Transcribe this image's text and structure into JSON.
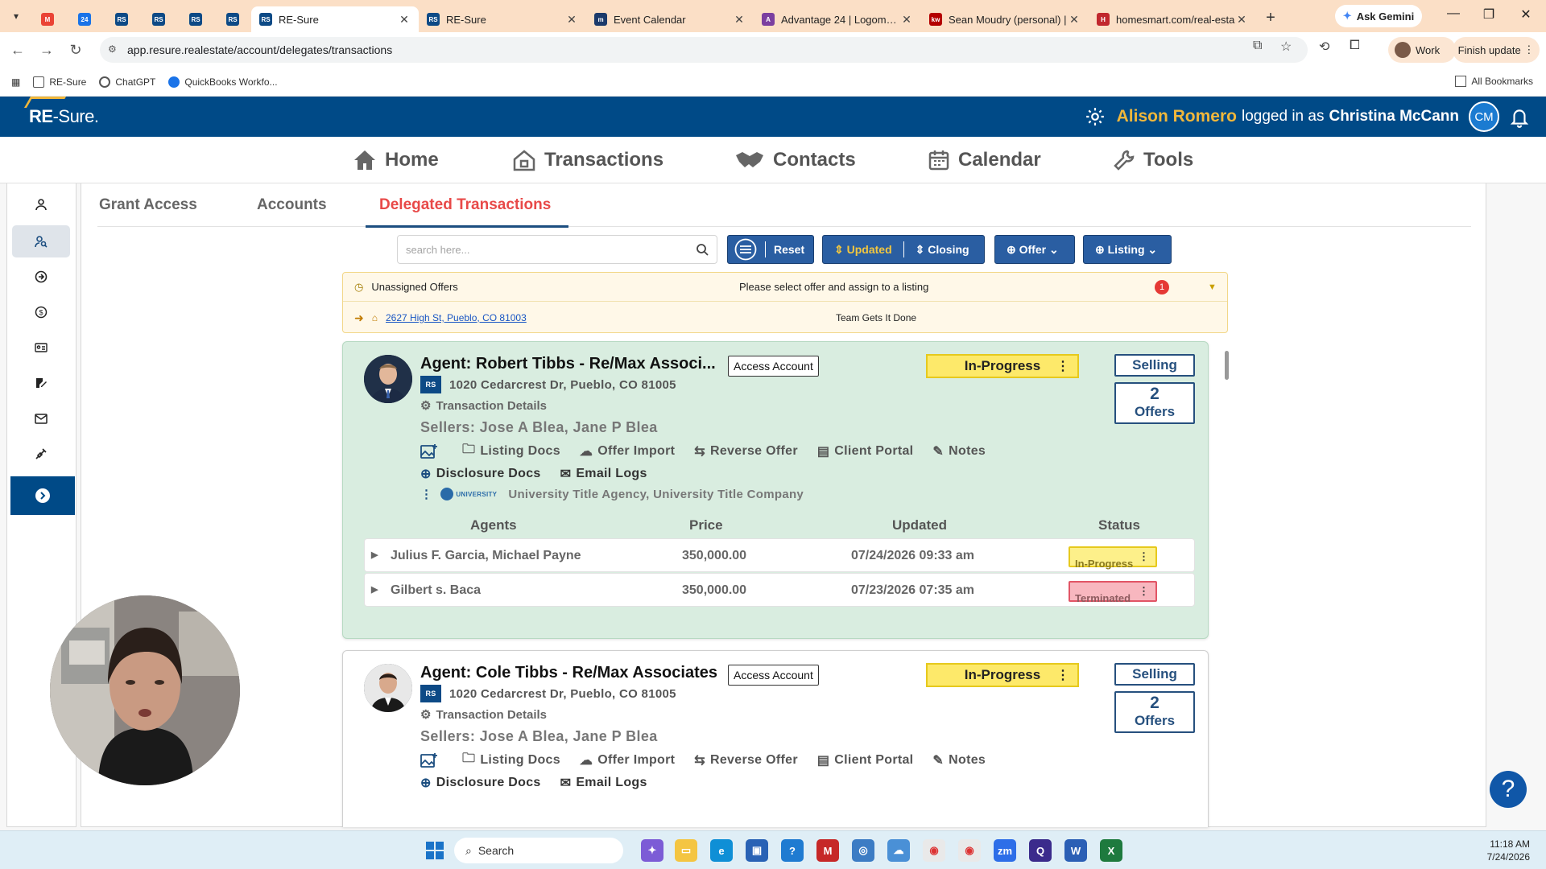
{
  "browser": {
    "tabs": [
      {
        "label": "",
        "favicon": "M",
        "color": "#ea4335",
        "pinned": true
      },
      {
        "label": "",
        "favicon": "24",
        "color": "#1a73e8",
        "pinned": true
      },
      {
        "label": "",
        "favicon": "RS",
        "color": "#0d4a86",
        "pinned": true
      },
      {
        "label": "",
        "favicon": "RS",
        "color": "#0d4a86",
        "pinned": true
      },
      {
        "label": "",
        "favicon": "RS",
        "color": "#0d4a86",
        "pinned": true
      },
      {
        "label": "",
        "favicon": "RS",
        "color": "#0d4a86",
        "pinned": true
      },
      {
        "label": "RE-Sure",
        "favicon": "RS",
        "color": "#0d4a86",
        "pinned": false,
        "active": true
      },
      {
        "label": "RE-Sure",
        "favicon": "RS",
        "color": "#0d4a86",
        "pinned": false
      },
      {
        "label": "Event Calendar",
        "favicon": "m",
        "color": "#1b3a6b",
        "pinned": false
      },
      {
        "label": "Advantage 24 | Logomark",
        "favicon": "A",
        "color": "#7b3fa0",
        "pinned": false
      },
      {
        "label": "Sean Moudry (personal) |",
        "favicon": "kw",
        "color": "#b40000",
        "pinned": false
      },
      {
        "label": "homesmart.com/real-esta",
        "favicon": "H",
        "color": "#c1272d",
        "pinned": false
      }
    ],
    "ask_gemini": "Ask Gemini",
    "url": "app.resure.realestate/account/delegates/transactions",
    "profile_label": "Work",
    "finish_update": "Finish update",
    "bookmarks": [
      "RE-Sure",
      "ChatGPT",
      "QuickBooks Workfo..."
    ],
    "all_bookmarks": "All Bookmarks"
  },
  "header": {
    "logo_main": "RE",
    "logo_sub": "-Sure.",
    "user_name": "Alison Romero",
    "logged_in_as": "logged in as",
    "impersonated": "Christina McCann",
    "avatar_initials": "CM"
  },
  "nav": {
    "home": "Home",
    "transactions": "Transactions",
    "contacts": "Contacts",
    "calendar": "Calendar",
    "tools": "Tools"
  },
  "subtabs": {
    "grant_access": "Grant Access",
    "accounts": "Accounts",
    "delegated": "Delegated Transactions"
  },
  "filters": {
    "search_placeholder": "search here...",
    "reset": "Reset",
    "updated": "Updated",
    "closing": "Closing",
    "offer": "Offer",
    "listing": "Listing"
  },
  "unassigned": {
    "title": "Unassigned Offers",
    "message": "Please select offer and assign to a listing",
    "count": "1",
    "address": "2627 High St, Pueblo, CO 81003",
    "team": "Team Gets It Done"
  },
  "cards": [
    {
      "agent": "Agent: Robert Tibbs - Re/Max Associ...",
      "access_label": "Access Account",
      "status": "In-Progress",
      "side": "Selling",
      "offers_count": "2",
      "offers_label": "Offers",
      "address": "1020 Cedarcrest Dr, Pueblo, CO 81005",
      "details": "Transaction Details",
      "sellers": "Sellers: Jose A Blea, Jane P Blea",
      "listing_docs": "Listing Docs",
      "offer_import": "Offer Import",
      "reverse_offer": "Reverse Offer",
      "client_portal": "Client Portal",
      "notes": "Notes",
      "disclosure_docs": "Disclosure Docs",
      "email_logs": "Email Logs",
      "title_company": "University Title Agency, University Title Company",
      "table_headers": {
        "agents": "Agents",
        "price": "Price",
        "updated": "Updated",
        "status": "Status"
      },
      "offers": [
        {
          "agents": "Julius F. Garcia, Michael Payne",
          "price": "350,000.00",
          "updated": "07/24/2026 09:33 am",
          "status": "In-Progress"
        },
        {
          "agents": "Gilbert s. Baca",
          "price": "350,000.00",
          "updated": "07/23/2026 07:35 am",
          "status": "Terminated"
        }
      ]
    },
    {
      "agent": "Agent: Cole Tibbs - Re/Max Associates",
      "access_label": "Access Account",
      "status": "In-Progress",
      "side": "Selling",
      "offers_count": "2",
      "offers_label": "Offers",
      "address": "1020 Cedarcrest Dr, Pueblo, CO 81005",
      "details": "Transaction Details",
      "sellers": "Sellers: Jose A Blea, Jane P Blea",
      "listing_docs": "Listing Docs",
      "offer_import": "Offer Import",
      "reverse_offer": "Reverse Offer",
      "client_portal": "Client Portal",
      "notes": "Notes",
      "disclosure_docs": "Disclosure Docs",
      "email_logs": "Email Logs"
    }
  ],
  "help_label": "?",
  "taskbar": {
    "search": "Search",
    "time": "11:18 AM",
    "date": "7/24/2026"
  }
}
